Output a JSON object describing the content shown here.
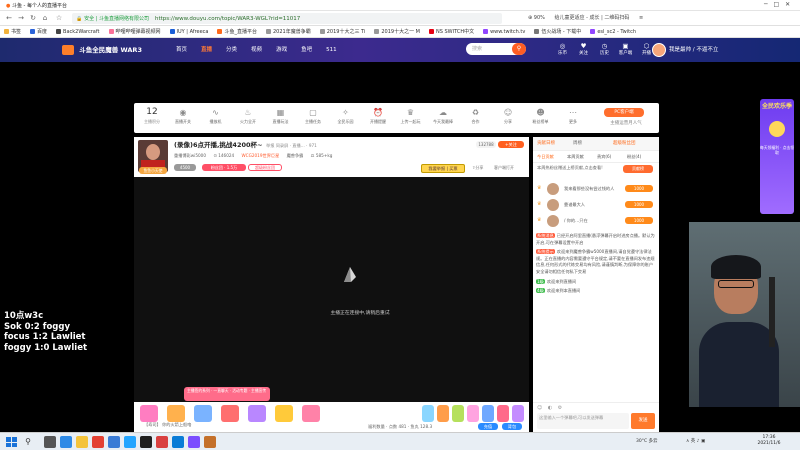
{
  "browser": {
    "tab_title": "斗鱼 - 每个人的直播平台",
    "security_label": "安全 | 斗鱼直播网络有限公司",
    "url": "https://www.douyu.com/topic/WAR3-WGL?rid=11017",
    "zoom": "90%",
    "right_text": "给儿童更适应 - 成长 | 二维码扫码"
  },
  "bookmarks": [
    {
      "label": "书签",
      "color": "#f2b23c"
    },
    {
      "label": "百度",
      "color": "#2b63d9"
    },
    {
      "label": "Back2Warcraft",
      "color": "#444"
    },
    {
      "label": "哔哩哔哩弹幕视频网",
      "color": "#fb7299"
    },
    {
      "label": "IUY | Afreeca",
      "color": "#1a5ed7"
    },
    {
      "label": "斗鱼_直播平台",
      "color": "#ff6a1a"
    },
    {
      "label": "2021年魔兽争霸",
      "color": "#999"
    },
    {
      "label": "2019十大之三 Ti",
      "color": "#999"
    },
    {
      "label": "2019十大之一 M",
      "color": "#999"
    },
    {
      "label": "NS SWITCH中文",
      "color": "#e60012"
    },
    {
      "label": "www.twitch.tv",
      "color": "#9146ff"
    },
    {
      "label": "伍火战场 - 下载中",
      "color": "#777"
    },
    {
      "label": "esl_sc2 - Twitch",
      "color": "#9146ff"
    }
  ],
  "header": {
    "logo_text": "斗鱼全民魔兽 WAR3",
    "nav": [
      "首页",
      "直播",
      "分类",
      "视频",
      "游戏",
      "鱼吧",
      "511"
    ],
    "active_nav": "直播",
    "search_placeholder": "搜索",
    "icons": [
      {
        "name": "ticket-icon",
        "label": "乐币",
        "glyph": "◎"
      },
      {
        "name": "follow-icon",
        "label": "关注",
        "glyph": "♥"
      },
      {
        "name": "history-icon",
        "label": "历史",
        "glyph": "◷"
      },
      {
        "name": "message-icon",
        "label": "客户端",
        "glyph": "▣"
      },
      {
        "name": "streamer-icon",
        "label": "开播",
        "glyph": "⬡"
      }
    ],
    "username": "我是最帅 / 不逼不立"
  },
  "toolbar": {
    "count": "12",
    "count_label": "主播积分",
    "items": [
      {
        "icon": "toggle-icon",
        "glyph": "◉",
        "label": "直播开关"
      },
      {
        "icon": "wave-icon",
        "glyph": "∿",
        "label": "播放机"
      },
      {
        "icon": "fire-icon",
        "glyph": "♨",
        "label": "火力全开"
      },
      {
        "icon": "chart-icon",
        "glyph": "▦",
        "label": "直播玩法"
      },
      {
        "icon": "bag-icon",
        "glyph": "▢",
        "label": "主播任务"
      },
      {
        "icon": "gem-icon",
        "glyph": "✧",
        "label": "全民乐园"
      },
      {
        "icon": "alarm-icon",
        "glyph": "⏰",
        "label": "开播提醒"
      },
      {
        "icon": "bulb-icon",
        "glyph": "♛",
        "label": "上传一起玩"
      },
      {
        "icon": "cloud-icon",
        "glyph": "☁",
        "label": "今天我最棒"
      },
      {
        "icon": "cycle-icon",
        "glyph": "♻",
        "label": "合作"
      },
      {
        "icon": "happy-icon",
        "glyph": "☺",
        "label": "分享"
      },
      {
        "icon": "user-icon",
        "glyph": "☻",
        "label": "粉丝榜单"
      },
      {
        "icon": "more-icon",
        "glyph": "⋯",
        "label": "更多"
      }
    ],
    "pc_btn": "PC客户端",
    "pc_sub": "主播运营月人气"
  },
  "stream": {
    "title": "(录像)6点开播,挑战4200杯~",
    "title_meta": "举报  同录屏  ·  直播…  ·  971",
    "uploader": "重播博彩wi5000",
    "viewers": "146024",
    "category": "WCG2019世界巨星",
    "cat_small": "魔兽争霸",
    "fans": "585+kg",
    "avatar_badge": "鱼鱼小天使",
    "level_tag": "4500",
    "fans_tag": "粉丝团 · 1.5万",
    "more_tag": "超级粉丝团",
    "follow_count": "132788",
    "follow_label": "+关注",
    "report_btn": "我要举报 | 买票",
    "share_label": "分享",
    "client_label": "客户端打开",
    "video_message": "主播正在连接中,请稍后重试",
    "promo": "主播签约系列 · 一直聊天 · 活动专题 · 主播宣传",
    "bottom_text": "【寿司】 你的火箭上船咯",
    "bottom_right": "福利数量 · 点数  481  ·  鱼丸  128.3",
    "recharge": "充值",
    "bag": "背包"
  },
  "overlay": {
    "lines": [
      "10点w3c",
      "Sok 0:2 foggy",
      "focus 1:2 Lawliet",
      "foggy 1:0 Lawliet"
    ]
  },
  "sidepanel": {
    "header_left": "贡献日榜",
    "header_mid": "周榜",
    "header_right": "超级粉丝团",
    "tabs": [
      "今日贡献",
      "本周贡献",
      "贵宾(6)",
      "粉丝(4)"
    ],
    "notice": "本周热粉丝赠送上榜贡献,点击查看!",
    "notice_btn": "贡献榜",
    "ranks": [
      {
        "no": "1",
        "text": "我来看那些没有尝过钱的人",
        "score": "1000"
      },
      {
        "no": "2",
        "text": "靠谱最大人",
        "score": "1000"
      },
      {
        "no": "3",
        "text": "/ 你的…只在",
        "score": "1000"
      }
    ],
    "chat": [
      {
        "tag": "系统消息",
        "type": "sys",
        "text": "已经开启阿里直播(悬浮弹幕开启时进房点播。默认为开启,可在弹幕设置中开启"
      },
      {
        "tag": "系统提示",
        "type": "sys",
        "text": "欢迎来到魔兽争霸w5000直播间,请自觉遵守法律法规。正在直播的内容需要遵守平台规定,请不要在直播间发布违规信息,任何形式的代练交易均有风险,请谨慎判断,为保障你的账户安全请勿相信任何私下交易"
      },
      {
        "tag": "1级",
        "type": "lv",
        "text": "欢迎来到直播间"
      },
      {
        "tag": "4级",
        "type": "lv",
        "text": "欢迎来到本直播间"
      }
    ],
    "input_placeholder": "这里输入一个弹幕吧,可以发送弹幕",
    "send_btn": "发送"
  },
  "ad": {
    "title": "全民欢乐季",
    "sub": "每天领福利 · 点击领取"
  },
  "taskbar": {
    "weather": "30°C 多云",
    "tray": "∧ 英 ♪ ▣",
    "time": "17:36",
    "date": "2021/11/6",
    "apps": [
      {
        "icon": "taskview-icon",
        "color": "#555"
      },
      {
        "icon": "edge-icon",
        "color": "#2e8ae6"
      },
      {
        "icon": "folder-icon",
        "color": "#f4c33a"
      },
      {
        "icon": "chrome-icon",
        "color": "#e34133"
      },
      {
        "icon": "store-icon",
        "color": "#3a7bd5"
      },
      {
        "icon": "qq-icon",
        "color": "#23a5ff"
      },
      {
        "icon": "obs-icon",
        "color": "#1f1f1f"
      },
      {
        "icon": "music-icon",
        "color": "#d94040"
      },
      {
        "icon": "mail-icon",
        "color": "#0a7cd6"
      },
      {
        "icon": "game-icon",
        "color": "#7b4eff"
      },
      {
        "icon": "warcraft-icon",
        "color": "#c4702a"
      }
    ]
  }
}
